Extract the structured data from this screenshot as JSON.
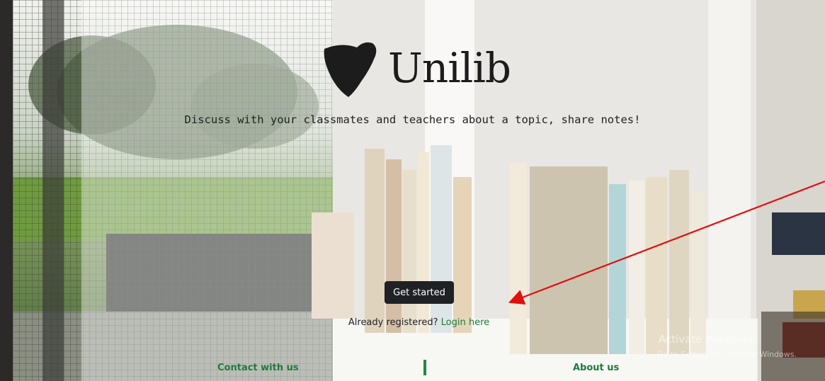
{
  "brand": {
    "name": "Unilib"
  },
  "hero": {
    "tagline": "Discuss with your classmates and teachers about a topic, share notes!",
    "cta_label": "Get started",
    "registered_prompt": "Already registered?",
    "login_link": "Login here"
  },
  "footer": {
    "contact_label": "Contact with us",
    "about_label": "About us"
  },
  "os_watermark": {
    "title": "Activate Windows",
    "subtitle": "Go to Settings to activate Windows."
  },
  "colors": {
    "link_green": "#1e7b3d",
    "button_dark": "#1f2125",
    "annotation_red": "#e01010"
  }
}
